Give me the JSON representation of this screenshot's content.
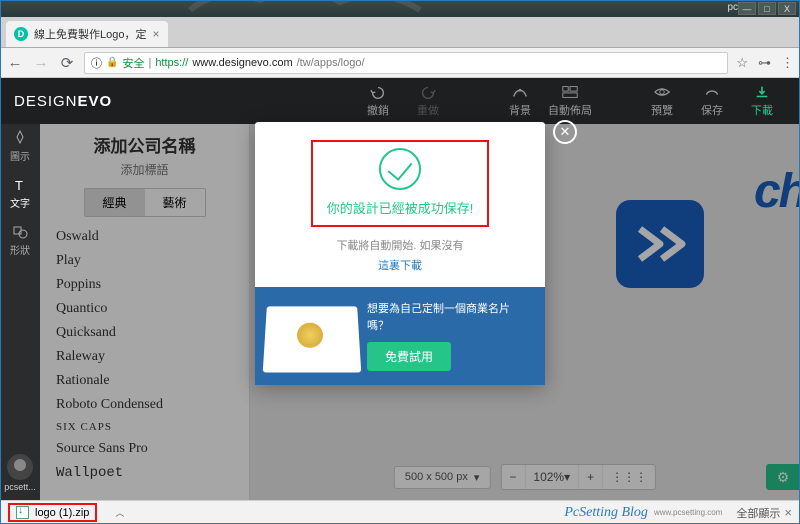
{
  "os": {
    "user": "pc",
    "min": "—",
    "max": "□",
    "close": "X"
  },
  "browser": {
    "tab_title": "線上免費製作Logo，定",
    "tab_close": "×",
    "secure_label": "安全",
    "url_scheme": "https://",
    "url_host": "www.designevo.com",
    "url_path": "/tw/apps/logo/",
    "star": "☆",
    "key": "⊶",
    "menu": "⋮"
  },
  "header": {
    "brand1": "DESIGN",
    "brand2": "EVO",
    "undo": "撤銷",
    "redo": "重做",
    "bg": "背景",
    "auto": "自動佈局",
    "preview": "預覽",
    "save": "保存",
    "download": "下載"
  },
  "sidebar": {
    "items": [
      {
        "label": "圖示"
      },
      {
        "label": "文字"
      },
      {
        "label": "形狀"
      }
    ],
    "username": "pcsett..."
  },
  "panel": {
    "company": "添加公司名稱",
    "slogan": "添加標語",
    "tab_classic": "經典",
    "tab_art": "藝術",
    "fonts": [
      "Oswald",
      "Play",
      "Poppins",
      "Quantico",
      "Quicksand",
      "Raleway",
      "Rationale",
      "Roboto Condensed",
      "Six Caps",
      "Source Sans Pro",
      "Wallpoet"
    ]
  },
  "canvas": {
    "logo_text": "ch",
    "size_label": "500 x 500 px",
    "zoom_minus": "−",
    "zoom_val": "102%",
    "zoom_plus": "+"
  },
  "modal": {
    "success": "你的設計已經被成功保存!",
    "dl_hint": "下載將自動開始. 如果沒有",
    "dl_link": "這裏下載",
    "card_text": "想要為自己定制一個商業名片嗎？",
    "try_btn": "免費試用",
    "close": "✕"
  },
  "shelf": {
    "file": "logo (1).zip",
    "chev": "︿",
    "watermark": "PcSetting Blog",
    "wm_sub": "www.pcsetting.com",
    "show_all": "全部顯示",
    "close": "×"
  }
}
